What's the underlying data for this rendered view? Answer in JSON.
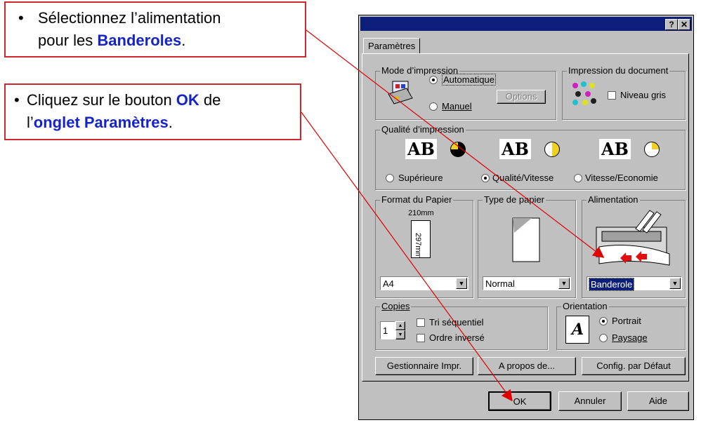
{
  "callouts": {
    "c1": {
      "bullet": "•",
      "line1": "Sélectionnez l’alimentation",
      "line2_pre": "pour les ",
      "line2_bold": "Banderoles",
      "line2_post": "."
    },
    "c2": {
      "bullet": "•",
      "line1_pre": "Cliquez sur le bouton ",
      "line1_bold": "OK",
      "line1_post": " de",
      "line2_pre": "l’",
      "line2_bold": "onglet Paramètres",
      "line2_post": "."
    }
  },
  "dialog": {
    "help_btn": "?",
    "close_btn": "✕",
    "tab": "Paramètres",
    "mode": {
      "legend": "Mode d’impression",
      "auto": "Automatique",
      "manuel": "Manuel",
      "options_btn": "Options"
    },
    "doc": {
      "legend": "Impression du document",
      "gris": "Niveau gris"
    },
    "qualite": {
      "legend": "Qualité d’impression",
      "ab": "AB",
      "sup": "Supérieure",
      "qv": "Qualité/Vitesse",
      "ve": "Vitesse/Economie"
    },
    "format": {
      "legend": "Format du Papier",
      "w": "210mm",
      "h": "297mm",
      "value": "A4"
    },
    "type": {
      "legend": "Type de papier",
      "value": "Normal"
    },
    "alim": {
      "legend": "Alimentation",
      "value": "Banderole"
    },
    "copies": {
      "legend": "Copies",
      "value": "1",
      "tri": "Tri séquentiel",
      "ordre": "Ordre inversé"
    },
    "orient": {
      "legend": "Orientation",
      "letter": "A",
      "portrait": "Portrait",
      "paysage": "Paysage"
    },
    "buttons": {
      "gest": "Gestionnaire Impr.",
      "apropos": "A propos de...",
      "config": "Config. par Défaut"
    },
    "footer": {
      "ok": "OK",
      "annuler": "Annuler",
      "aide": "Aide"
    }
  },
  "colors": {
    "accent": "#1524c9",
    "arrow": "#e00000",
    "titlebar": "#0a1e7a"
  }
}
